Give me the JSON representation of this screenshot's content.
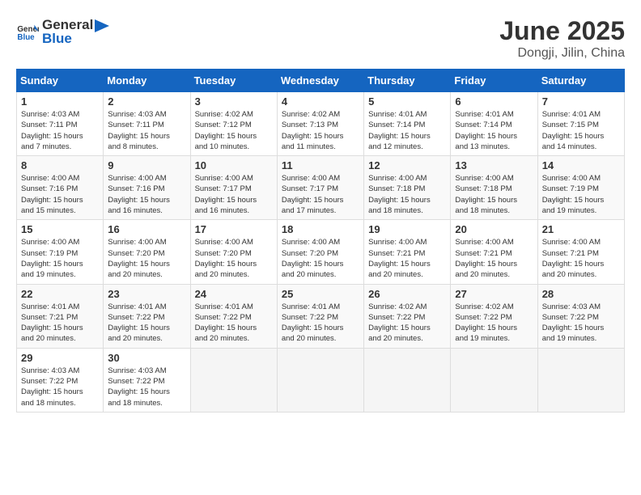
{
  "header": {
    "logo_general": "General",
    "logo_blue": "Blue",
    "month": "June 2025",
    "location": "Dongji, Jilin, China"
  },
  "weekdays": [
    "Sunday",
    "Monday",
    "Tuesday",
    "Wednesday",
    "Thursday",
    "Friday",
    "Saturday"
  ],
  "weeks": [
    [
      {
        "day": "1",
        "sunrise": "4:03 AM",
        "sunset": "7:11 PM",
        "daylight": "15 hours and 7 minutes."
      },
      {
        "day": "2",
        "sunrise": "4:03 AM",
        "sunset": "7:11 PM",
        "daylight": "15 hours and 8 minutes."
      },
      {
        "day": "3",
        "sunrise": "4:02 AM",
        "sunset": "7:12 PM",
        "daylight": "15 hours and 10 minutes."
      },
      {
        "day": "4",
        "sunrise": "4:02 AM",
        "sunset": "7:13 PM",
        "daylight": "15 hours and 11 minutes."
      },
      {
        "day": "5",
        "sunrise": "4:01 AM",
        "sunset": "7:14 PM",
        "daylight": "15 hours and 12 minutes."
      },
      {
        "day": "6",
        "sunrise": "4:01 AM",
        "sunset": "7:14 PM",
        "daylight": "15 hours and 13 minutes."
      },
      {
        "day": "7",
        "sunrise": "4:01 AM",
        "sunset": "7:15 PM",
        "daylight": "15 hours and 14 minutes."
      }
    ],
    [
      {
        "day": "8",
        "sunrise": "4:00 AM",
        "sunset": "7:16 PM",
        "daylight": "15 hours and 15 minutes."
      },
      {
        "day": "9",
        "sunrise": "4:00 AM",
        "sunset": "7:16 PM",
        "daylight": "15 hours and 16 minutes."
      },
      {
        "day": "10",
        "sunrise": "4:00 AM",
        "sunset": "7:17 PM",
        "daylight": "15 hours and 16 minutes."
      },
      {
        "day": "11",
        "sunrise": "4:00 AM",
        "sunset": "7:17 PM",
        "daylight": "15 hours and 17 minutes."
      },
      {
        "day": "12",
        "sunrise": "4:00 AM",
        "sunset": "7:18 PM",
        "daylight": "15 hours and 18 minutes."
      },
      {
        "day": "13",
        "sunrise": "4:00 AM",
        "sunset": "7:18 PM",
        "daylight": "15 hours and 18 minutes."
      },
      {
        "day": "14",
        "sunrise": "4:00 AM",
        "sunset": "7:19 PM",
        "daylight": "15 hours and 19 minutes."
      }
    ],
    [
      {
        "day": "15",
        "sunrise": "4:00 AM",
        "sunset": "7:19 PM",
        "daylight": "15 hours and 19 minutes."
      },
      {
        "day": "16",
        "sunrise": "4:00 AM",
        "sunset": "7:20 PM",
        "daylight": "15 hours and 20 minutes."
      },
      {
        "day": "17",
        "sunrise": "4:00 AM",
        "sunset": "7:20 PM",
        "daylight": "15 hours and 20 minutes."
      },
      {
        "day": "18",
        "sunrise": "4:00 AM",
        "sunset": "7:20 PM",
        "daylight": "15 hours and 20 minutes."
      },
      {
        "day": "19",
        "sunrise": "4:00 AM",
        "sunset": "7:21 PM",
        "daylight": "15 hours and 20 minutes."
      },
      {
        "day": "20",
        "sunrise": "4:00 AM",
        "sunset": "7:21 PM",
        "daylight": "15 hours and 20 minutes."
      },
      {
        "day": "21",
        "sunrise": "4:00 AM",
        "sunset": "7:21 PM",
        "daylight": "15 hours and 20 minutes."
      }
    ],
    [
      {
        "day": "22",
        "sunrise": "4:01 AM",
        "sunset": "7:21 PM",
        "daylight": "15 hours and 20 minutes."
      },
      {
        "day": "23",
        "sunrise": "4:01 AM",
        "sunset": "7:22 PM",
        "daylight": "15 hours and 20 minutes."
      },
      {
        "day": "24",
        "sunrise": "4:01 AM",
        "sunset": "7:22 PM",
        "daylight": "15 hours and 20 minutes."
      },
      {
        "day": "25",
        "sunrise": "4:01 AM",
        "sunset": "7:22 PM",
        "daylight": "15 hours and 20 minutes."
      },
      {
        "day": "26",
        "sunrise": "4:02 AM",
        "sunset": "7:22 PM",
        "daylight": "15 hours and 20 minutes."
      },
      {
        "day": "27",
        "sunrise": "4:02 AM",
        "sunset": "7:22 PM",
        "daylight": "15 hours and 19 minutes."
      },
      {
        "day": "28",
        "sunrise": "4:03 AM",
        "sunset": "7:22 PM",
        "daylight": "15 hours and 19 minutes."
      }
    ],
    [
      {
        "day": "29",
        "sunrise": "4:03 AM",
        "sunset": "7:22 PM",
        "daylight": "15 hours and 18 minutes."
      },
      {
        "day": "30",
        "sunrise": "4:03 AM",
        "sunset": "7:22 PM",
        "daylight": "15 hours and 18 minutes."
      },
      null,
      null,
      null,
      null,
      null
    ]
  ],
  "labels": {
    "sunrise": "Sunrise:",
    "sunset": "Sunset:",
    "daylight": "Daylight:"
  }
}
